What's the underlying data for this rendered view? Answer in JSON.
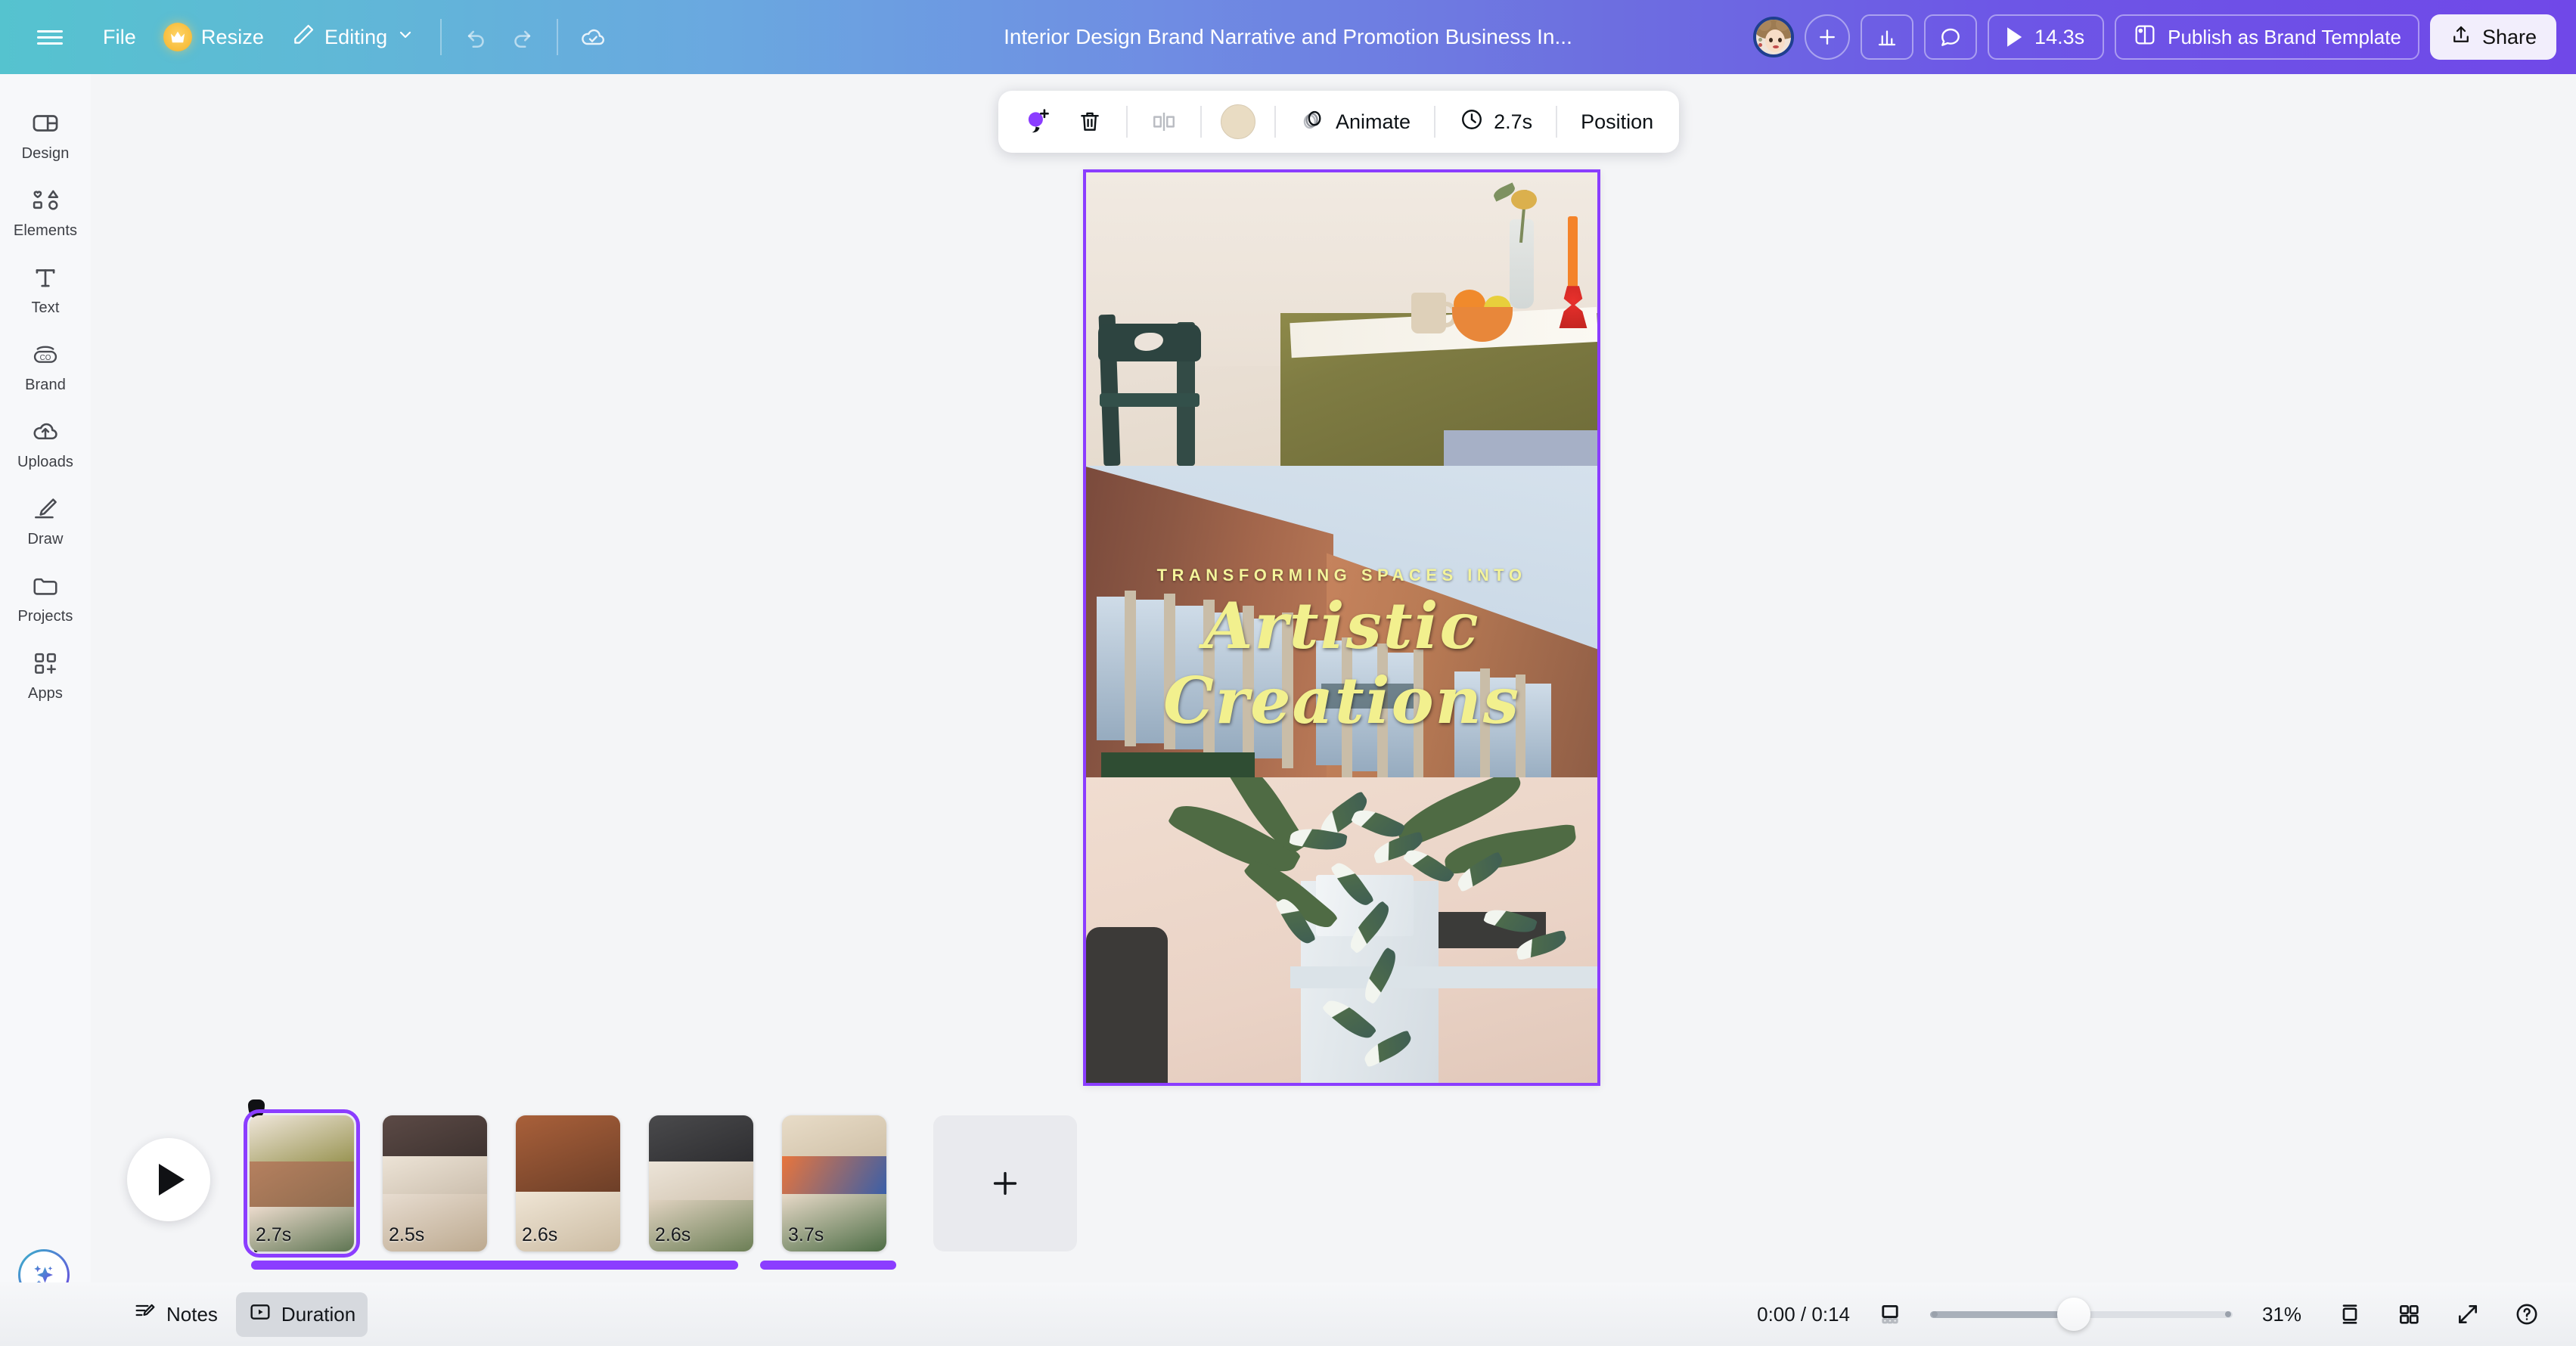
{
  "topbar": {
    "menu_icon": "hamburger-icon",
    "file_label": "File",
    "resize_label": "Resize",
    "resize_badge_icon": "crown-icon",
    "editing_label": "Editing",
    "editing_caret_icon": "chevron-down-icon",
    "undo_icon": "undo-icon",
    "redo_icon": "redo-icon",
    "saved_icon": "cloud-check-icon",
    "doc_title": "Interior Design Brand Narrative and Promotion  Business In...",
    "avatar_icon": "user-avatar",
    "add_member_icon": "plus-icon",
    "insights_icon": "bar-chart-icon",
    "comments_icon": "comment-bubble-icon",
    "play_icon": "play-icon",
    "play_duration": "14.3s",
    "publish_icon": "brand-template-icon",
    "publish_label": "Publish as Brand Template",
    "share_icon": "share-upload-icon",
    "share_label": "Share"
  },
  "sidebar": {
    "items": [
      {
        "label": "Design",
        "icon": "design-panel-icon"
      },
      {
        "label": "Elements",
        "icon": "shapes-icon"
      },
      {
        "label": "Text",
        "icon": "text-t-icon"
      },
      {
        "label": "Brand",
        "icon": "brand-co-icon"
      },
      {
        "label": "Uploads",
        "icon": "cloud-upload-icon"
      },
      {
        "label": "Draw",
        "icon": "pencil-draw-icon"
      },
      {
        "label": "Projects",
        "icon": "folder-icon"
      },
      {
        "label": "Apps",
        "icon": "apps-grid-plus-icon"
      }
    ]
  },
  "floating_toolbar": {
    "magic_icon": "magic-edit-icon",
    "delete_icon": "trash-icon",
    "flip_icon": "flip-icon",
    "color_swatch_icon": "color-swatch",
    "color_swatch_hex": "#E9DCC3",
    "animate_icon": "animate-icon",
    "animate_label": "Animate",
    "timer_icon": "clock-icon",
    "timer_label": "2.7s",
    "position_label": "Position"
  },
  "canvas": {
    "selection_color": "#8B3DFF",
    "overlay_kicker": "TRANSFORMING SPACES INTO",
    "overlay_script": "Artistic Creations",
    "overlay_text_color": "#F2F08E",
    "images": [
      {
        "alt": "dining-table-with-olive-tablecloth-and-fruit-bowl"
      },
      {
        "alt": "modern-brick-and-glass-building-facade-at-sunset"
      },
      {
        "alt": "variegated-houseplant-on-white-pedestal"
      }
    ]
  },
  "timeline": {
    "play_icon": "play-icon",
    "sparkle_icon": "magic-sparkle-icon",
    "playhead_icon": "playhead-marker",
    "add_slide_icon": "plus-icon",
    "slides": [
      {
        "duration": "2.7s",
        "selected": true,
        "alt": "dining-table-slide"
      },
      {
        "duration": "2.5s",
        "selected": false,
        "alt": "row-houses-slide"
      },
      {
        "duration": "2.6s",
        "selected": false,
        "alt": "doorway-steps-slide"
      },
      {
        "duration": "2.6s",
        "selected": false,
        "alt": "townhouse-bedroom-slide"
      },
      {
        "duration": "3.7s",
        "selected": false,
        "alt": "living-room-collage-slide"
      }
    ],
    "tracks": [
      {
        "color": "#8B3DFF"
      },
      {
        "color": "#8B3DFF"
      }
    ]
  },
  "bottombar": {
    "notes_icon": "notes-pencil-icon",
    "notes_label": "Notes",
    "duration_icon": "duration-play-icon",
    "duration_label": "Duration",
    "duration_active": true,
    "time_label": "0:00 / 0:14",
    "fit_icon": "fit-page-icon",
    "zoom_percent": "31%",
    "pages_icon": "page-view-icon",
    "grid_icon": "grid-view-icon",
    "fullscreen_icon": "expand-arrows-icon",
    "help_icon": "help-question-icon"
  }
}
